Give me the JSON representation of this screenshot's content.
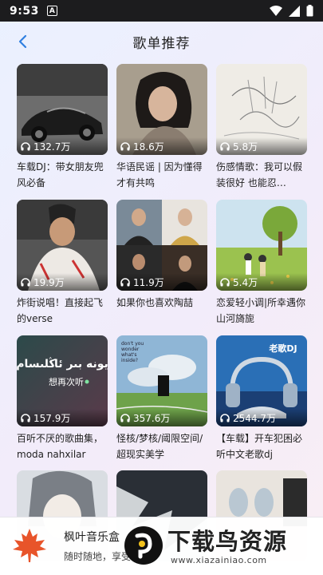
{
  "status_bar": {
    "time": "9:53",
    "notification_badge": "A"
  },
  "header": {
    "title": "歌单推荐"
  },
  "playlists": [
    {
      "plays": "132.7万",
      "title": "车载DJ：带女朋友兜风必备"
    },
    {
      "plays": "18.6万",
      "title": "华语民谣 | 因为懂得才有共鸣"
    },
    {
      "plays": "5.8万",
      "title": "伤感情歌：我可以假装很好 也能忍…"
    },
    {
      "plays": "19.9万",
      "title": "炸街说唱！直接起飞的verse"
    },
    {
      "plays": "11.9万",
      "title": "如果你也喜欢陶喆"
    },
    {
      "plays": "5.4万",
      "title": "恋爱轻小调|所幸遇你 山河旖旎"
    },
    {
      "plays": "157.9万",
      "title": "百听不厌的歌曲集，moda nahxilar"
    },
    {
      "plays": "357.6万",
      "title": "怪核/梦核/阈限空间/超现实美学"
    },
    {
      "plays": "2544.7万",
      "title": "【车载】开车犯困必听中文老歌dj"
    },
    {
      "plays": "",
      "title": ""
    },
    {
      "plays": "",
      "title": ""
    },
    {
      "plays": "",
      "title": ""
    }
  ],
  "artwork_text": {
    "uyghur_line": "يونە بىر ئاڭلىسام",
    "chinese_line": "想再次听",
    "dont_you_wonder": "don't you wonder what's inside?",
    "old_songs_dj": "老歌DJ"
  },
  "bottom_bar": {
    "app_name": "枫叶音乐盒",
    "app_subtitle": "随时随地，享受音乐"
  },
  "watermark": {
    "text": "下载鸟资源",
    "url": "www.xiazainiao.com"
  },
  "colors": {
    "status_bar": "#1c1c1e",
    "accent": "#2f7fe0",
    "logo": "#e8542a"
  }
}
